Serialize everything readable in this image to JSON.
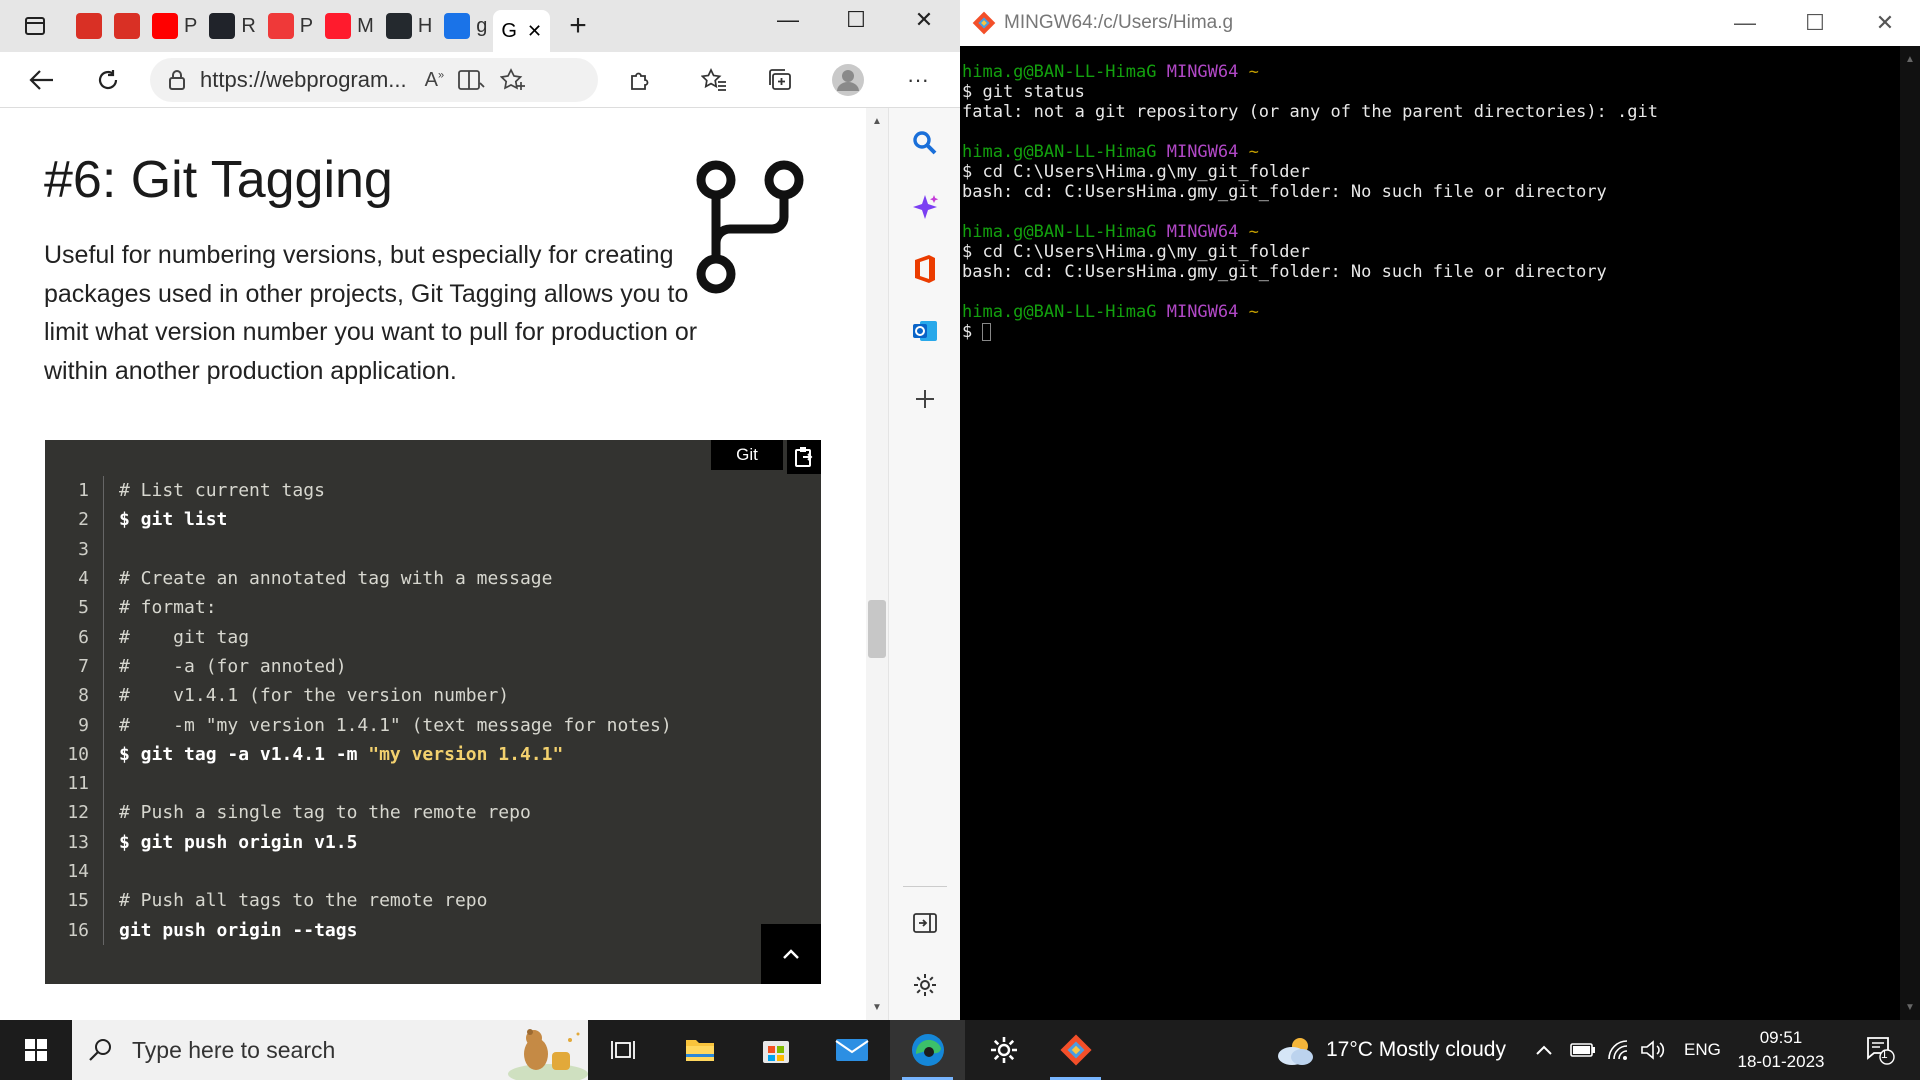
{
  "browser": {
    "tabs": [
      {
        "label": "",
        "icon": "pdf-icon",
        "color": "#d93025"
      },
      {
        "label": "",
        "icon": "pdf-icon",
        "color": "#d93025"
      },
      {
        "label": "P",
        "icon": "youtube-icon",
        "color": "#ff0000"
      },
      {
        "label": "R",
        "icon": "react-icon",
        "color": "#20232a"
      },
      {
        "label": "P",
        "icon": "vivaldi-icon",
        "color": "#ef3939"
      },
      {
        "label": "M",
        "icon": "opera-icon",
        "color": "#ff1b2d"
      },
      {
        "label": "H",
        "icon": "github-icon",
        "color": "#24292e"
      },
      {
        "label": "g",
        "icon": "search-icon",
        "color": "#1a73e8"
      }
    ],
    "active_tab": {
      "label": "G",
      "close": "✕"
    },
    "new_tab": "+",
    "window_controls": {
      "minimize": "—",
      "maximize": "☐",
      "close": "✕"
    },
    "url": "https://webprogram...",
    "page": {
      "title": "#6: Git Tagging",
      "paragraph": "Useful for numbering versions, but especially for creating packages used in other projects, Git Tagging allows you to limit what version number you want to pull for production or within another production application."
    },
    "code": {
      "language": "Git",
      "lines": [
        {
          "n": "1",
          "type": "cm",
          "text": "# List current tags"
        },
        {
          "n": "2",
          "type": "cmd",
          "text": "$ git list"
        },
        {
          "n": "3",
          "type": "cm",
          "text": ""
        },
        {
          "n": "4",
          "type": "cm",
          "text": "# Create an annotated tag with a message"
        },
        {
          "n": "5",
          "type": "cm",
          "text": "# format:"
        },
        {
          "n": "6",
          "type": "cm",
          "text": "#    git tag"
        },
        {
          "n": "7",
          "type": "cm",
          "text": "#    -a (for annoted)"
        },
        {
          "n": "8",
          "type": "cm",
          "text": "#    v1.4.1 (for the version number)"
        },
        {
          "n": "9",
          "type": "cm",
          "text": "#    -m \"my version 1.4.1\" (text message for notes)"
        },
        {
          "n": "10",
          "type": "cmdstr",
          "text": "$ git tag -a v1.4.1 -m ",
          "str": "\"my version 1.4.1\""
        },
        {
          "n": "11",
          "type": "cm",
          "text": ""
        },
        {
          "n": "12",
          "type": "cm",
          "text": "# Push a single tag to the remote repo"
        },
        {
          "n": "13",
          "type": "cmd",
          "text": "$ git push origin v1.5"
        },
        {
          "n": "14",
          "type": "cm",
          "text": ""
        },
        {
          "n": "15",
          "type": "cm",
          "text": "# Push all tags to the remote repo"
        },
        {
          "n": "16",
          "type": "cmd",
          "text": "git push origin --tags"
        }
      ]
    },
    "sidebar": [
      "search-icon",
      "copilot-icon",
      "office-icon",
      "outlook-icon",
      "add-icon",
      "hide-sidebar-icon",
      "settings-icon"
    ]
  },
  "terminal": {
    "title": "MINGW64:/c/Users/Hima.g",
    "window_controls": {
      "minimize": "—",
      "maximize": "☐",
      "close": "✕"
    },
    "blocks": [
      {
        "user": "hima.g@BAN-LL-HimaG",
        "env": "MINGW64",
        "path": "~",
        "cmd": "$ git status",
        "out": "fatal: not a git repository (or any of the parent directories): .git"
      },
      {
        "user": "hima.g@BAN-LL-HimaG",
        "env": "MINGW64",
        "path": "~",
        "cmd": "$ cd C:\\Users\\Hima.g\\my_git_folder",
        "out": "bash: cd: C:UsersHima.gmy_git_folder: No such file or directory"
      },
      {
        "user": "hima.g@BAN-LL-HimaG",
        "env": "MINGW64",
        "path": "~",
        "cmd": "$ cd C:\\Users\\Hima.g\\my_git_folder",
        "out": "bash: cd: C:UsersHima.gmy_git_folder: No such file or directory"
      },
      {
        "user": "hima.g@BAN-LL-HimaG",
        "env": "MINGW64",
        "path": "~",
        "cmd": "$ ",
        "out": ""
      }
    ]
  },
  "taskbar": {
    "search_placeholder": "Type here to search",
    "weather": "17°C  Mostly cloudy",
    "language": "ENG",
    "time": "09:51",
    "date": "18-01-2023",
    "notifications": "1"
  }
}
